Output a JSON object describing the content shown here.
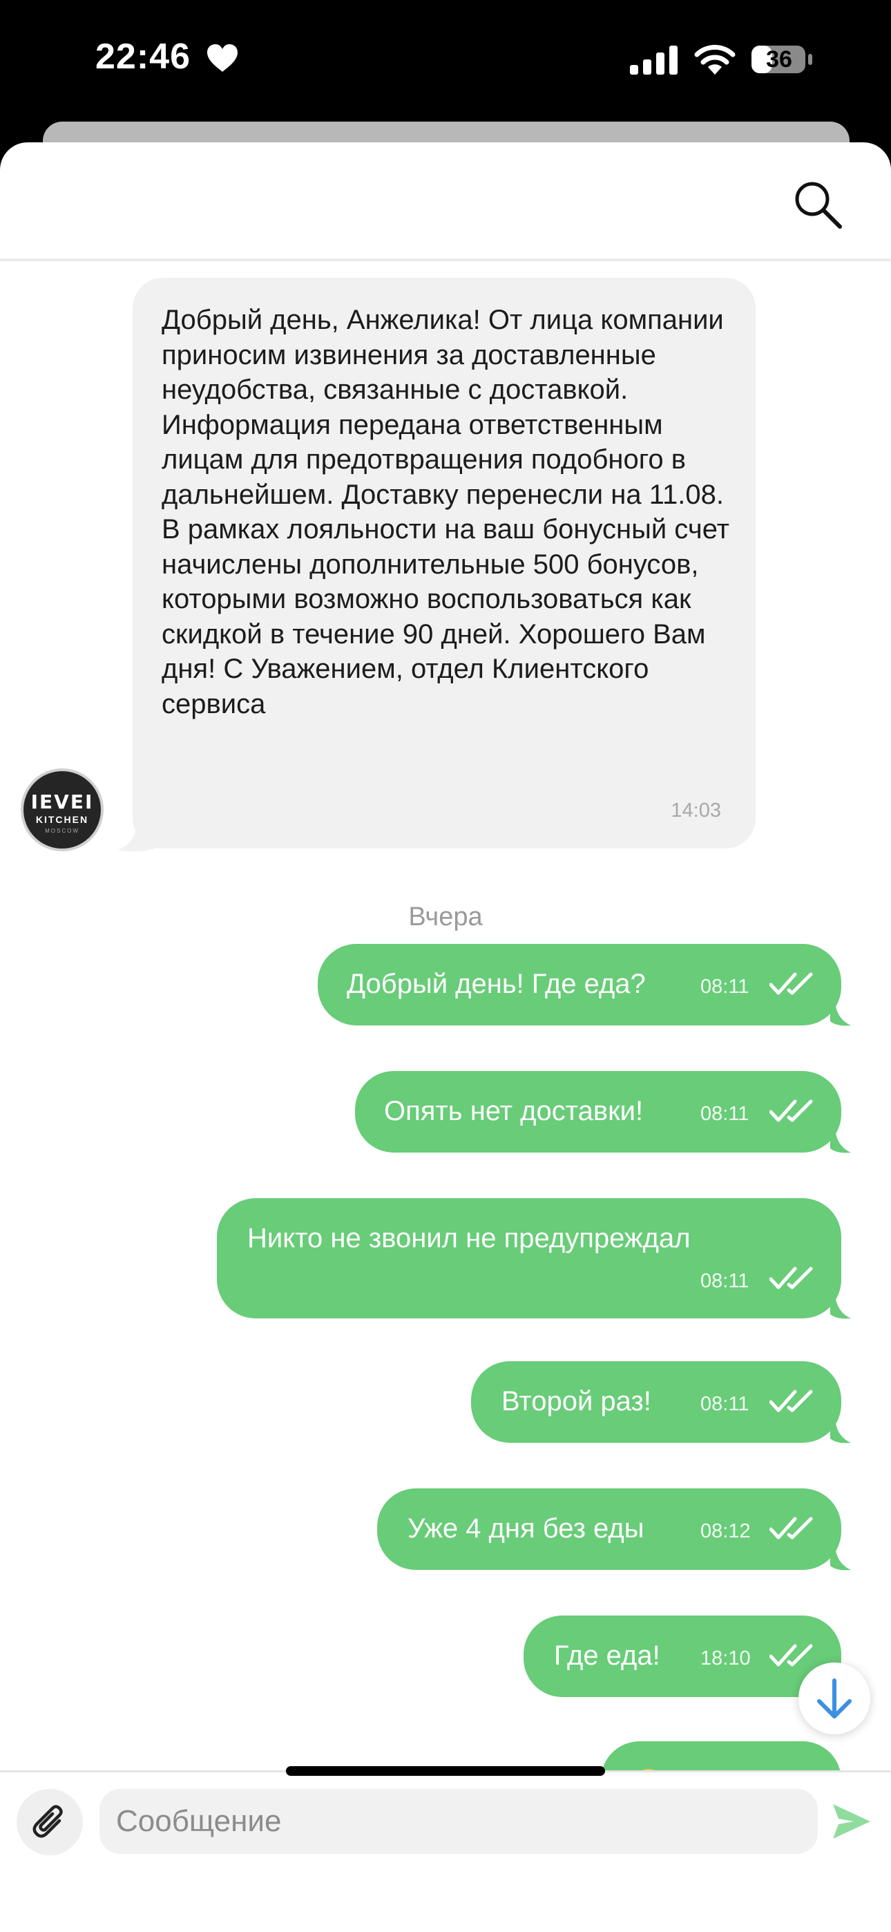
{
  "status_bar": {
    "time": "22:46",
    "battery": "36"
  },
  "incoming": {
    "avatar": {
      "line1": "IEVEI",
      "line2": "KITCHEN",
      "line3": "MOSCOW"
    },
    "text": "Добрый день, Анжелика! От лица компании приносим извинения за доставленные неудобства, связанные с доставкой. Информация передана ответственным лицам для предотвращения подобного в дальнейшем. Доставку перенесли на 11.08. В рамках лояльности на ваш бонусный счет начислены дополнительные 500 бонусов, которыми возможно воспользоваться как скидкой в течение 90 дней. Хорошего Вам дня! С Уважением, отдел Клиентского сервиса",
    "time": "14:03"
  },
  "date_separator": "Вчера",
  "outgoing": [
    {
      "text": "Добрый день! Где еда?",
      "time": "08:11"
    },
    {
      "text": "Опять нет доставки!",
      "time": "08:11"
    },
    {
      "text": "Никто не звонил не предупреждал",
      "time": "08:11"
    },
    {
      "text": "Второй раз!",
      "time": "08:11"
    },
    {
      "text": "Уже 4 дня без еды",
      "time": "08:12"
    },
    {
      "text": "Где еда!",
      "time": "18:10"
    }
  ],
  "composer": {
    "placeholder": "Сообщение"
  },
  "colors": {
    "outgoing_bubble": "#68cc78",
    "incoming_bubble": "#f1f1f2",
    "scroll_arrow": "#3d8fe0",
    "send": "#8fdc9d"
  },
  "icons": [
    "heart-icon",
    "signal-icon",
    "wifi-icon",
    "battery-icon",
    "search-icon",
    "double-check-icon",
    "arrow-down-icon",
    "paperclip-icon",
    "send-icon"
  ]
}
